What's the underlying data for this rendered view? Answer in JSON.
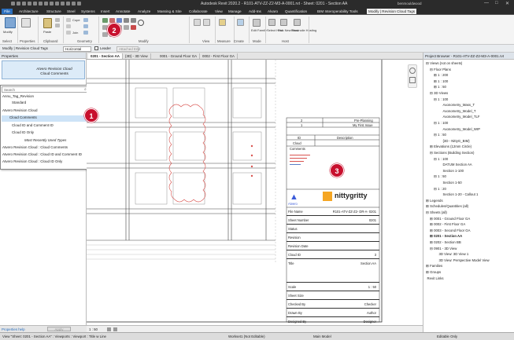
{
  "titlebar": {
    "title": "Autodesk Revit 2020.2 - R101-ATV-ZZ-Z2-M3-A-0001.rvt - Sheet: 0201 - Section AA",
    "user": "benmouldwood",
    "min": "—",
    "max": "□",
    "close": "✕"
  },
  "tabs": [
    "File",
    "Architecture",
    "Structure",
    "Steel",
    "Systems",
    "Insert",
    "Annotate",
    "Analyze",
    "Massing & Site",
    "Collaborate",
    "View",
    "Manage",
    "Add-Ins",
    "Alvaro",
    "Quantification",
    "BIM Interoperability Tools",
    "Modify | Revision Cloud Tags"
  ],
  "ribbon": {
    "modify": "Modify",
    "paste": "Paste",
    "cut": "Cope",
    "join": "Join",
    "edit_family": "Edit Family",
    "select_host": "Select Host",
    "pick_new_host": "Pick New Host",
    "reconcile_hosting": "Reconcile Hosting",
    "groups": [
      "Select",
      "Properties",
      "Clipboard",
      "Geometry",
      "Modify",
      "View",
      "Measure",
      "Create",
      "Mode",
      "Host"
    ]
  },
  "ctxbar": {
    "label": "Modify | Revision Cloud Tags",
    "orientation": "Horizontal",
    "leader": "Leader",
    "attached_end": "Attached End"
  },
  "properties": {
    "header": "Properties",
    "type_name": "Atvero Revision Cloud",
    "type_sub": "Cloud Comments",
    "search_placeholder": "Search",
    "items": [
      {
        "label": "Annu_Tag_Revision",
        "kind": "group"
      },
      {
        "label": "Standard",
        "kind": "item"
      },
      {
        "label": "Atvero Revision Cloud",
        "kind": "group"
      },
      {
        "label": "Cloud Comments",
        "kind": "selected"
      },
      {
        "label": "Cloud ID and Comment ID",
        "kind": "item"
      },
      {
        "label": "Cloud ID Only",
        "kind": "item"
      },
      {
        "label": "Most Recently Used Types",
        "kind": "italic"
      },
      {
        "label": "Atvero Revision Cloud : Cloud Comments",
        "kind": "group"
      },
      {
        "label": "Atvero Revision Cloud : Cloud ID and Comment ID",
        "kind": "group"
      },
      {
        "label": "Atvero Revision Cloud : Cloud ID Only",
        "kind": "group"
      }
    ],
    "help": "Properties help",
    "apply": "Apply"
  },
  "viewtabs": [
    "0201 - Section AA",
    "{3D} - 3D View",
    "0001 - Ground Floor GA",
    "0002 - First Floor GA"
  ],
  "titleblock": {
    "rev_rows": [
      {
        "rev": "2",
        "desc": "Pre-Planning"
      },
      {
        "rev": "1",
        "desc": "My First Issue"
      }
    ],
    "id_header": "ID",
    "desc_header": "Description",
    "cloud_label": "Cloud",
    "comments_label": "Comments",
    "brand": "Atvero",
    "company": "nittygritty",
    "fields": [
      {
        "k": "File Name",
        "v": "R101-ATV-ZZ-Z2- DR-A- 0201"
      },
      {
        "k": "Sheet Number",
        "v": "0201"
      },
      {
        "k": "Status",
        "v": ""
      },
      {
        "k": "Revision",
        "v": ""
      },
      {
        "k": "Revision Date",
        "v": ""
      },
      {
        "k": "Cloud ID",
        "v": "3"
      },
      {
        "k": "Title",
        "v": "Section AA"
      },
      {
        "k": "Scale",
        "v": "1 : 50"
      },
      {
        "k": "Sheet Size",
        "v": ""
      },
      {
        "k": "Checked By",
        "v": "Checker"
      },
      {
        "k": "Drawn By",
        "v": "Author"
      },
      {
        "k": "Designed By",
        "v": "Designer"
      }
    ]
  },
  "viewbottom": {
    "scale": "1 : 50"
  },
  "browser": {
    "header": "Project Browser - R101-ATV-ZZ-Z2-M3-A-0001.rvt",
    "nodes": [
      {
        "t": "Views (not on sheets)",
        "lvl": 0,
        "exp": "⊟"
      },
      {
        "t": "Floor Plans",
        "lvl": 1,
        "exp": "⊟"
      },
      {
        "t": "1 : 200",
        "lvl": 2,
        "exp": "⊞"
      },
      {
        "t": "1 : 100",
        "lvl": 2,
        "exp": "⊞"
      },
      {
        "t": "1 : 50",
        "lvl": 2,
        "exp": "⊞"
      },
      {
        "t": "3D Views",
        "lvl": 1,
        "exp": "⊟"
      },
      {
        "t": "1 : 100",
        "lvl": 2,
        "exp": "⊟"
      },
      {
        "t": "Axonometry_Mass_T",
        "lvl": 4,
        "exp": ""
      },
      {
        "t": "Axonometry_Model_T",
        "lvl": 4,
        "exp": ""
      },
      {
        "t": "Axonometry_Model_TLF",
        "lvl": 4,
        "exp": ""
      },
      {
        "t": "1 : 100",
        "lvl": 2,
        "exp": "⊟"
      },
      {
        "t": "Axonometry_Model_WIP",
        "lvl": 4,
        "exp": ""
      },
      {
        "t": "1 : 50",
        "lvl": 2,
        "exp": "⊟"
      },
      {
        "t": "{3D - NittyG_BIM}",
        "lvl": 4,
        "exp": ""
      },
      {
        "t": "Elevations (12mm Circle)",
        "lvl": 1,
        "exp": "⊞"
      },
      {
        "t": "Sections (Building Section)",
        "lvl": 1,
        "exp": "⊟"
      },
      {
        "t": "1 : 100",
        "lvl": 2,
        "exp": "⊟"
      },
      {
        "t": "DATUM Section AA",
        "lvl": 4,
        "exp": ""
      },
      {
        "t": "Section 1-100",
        "lvl": 4,
        "exp": ""
      },
      {
        "t": "1 : 50",
        "lvl": 2,
        "exp": "⊟"
      },
      {
        "t": "Section 1-50",
        "lvl": 4,
        "exp": ""
      },
      {
        "t": "1 : 20",
        "lvl": 2,
        "exp": "⊟"
      },
      {
        "t": "Section 1-20 - Callout 1",
        "lvl": 4,
        "exp": ""
      },
      {
        "t": "Legends",
        "lvl": 0,
        "exp": "⊞"
      },
      {
        "t": "Schedules/Quantities (all)",
        "lvl": 0,
        "exp": "⊞"
      },
      {
        "t": "Sheets (all)",
        "lvl": 0,
        "exp": "⊟"
      },
      {
        "t": "0001 - Ground Floor GA",
        "lvl": 1,
        "exp": "⊞"
      },
      {
        "t": "0002 - First Floor GA",
        "lvl": 1,
        "exp": "⊞"
      },
      {
        "t": "0003 - Second Floor GA",
        "lvl": 1,
        "exp": "⊞"
      },
      {
        "t": "0201 - Section AA",
        "lvl": 1,
        "exp": "⊞",
        "bold": true
      },
      {
        "t": "0202 - Section BB",
        "lvl": 1,
        "exp": "⊞"
      },
      {
        "t": "0901 - 3D View",
        "lvl": 1,
        "exp": "⊟"
      },
      {
        "t": "3D View: 3D View 1",
        "lvl": 3,
        "exp": ""
      },
      {
        "t": "3D View: Perspective Model View",
        "lvl": 3,
        "exp": ""
      },
      {
        "t": "Families",
        "lvl": 0,
        "exp": "⊞"
      },
      {
        "t": "Groups",
        "lvl": 0,
        "exp": "⊞"
      },
      {
        "t": "Revit Links",
        "lvl": 0,
        "exp": ""
      }
    ]
  },
  "status": {
    "text": "View \"Sheet: 0201 - Section AA\" : Viewports : Viewport : Title w Line",
    "workset": "Workset1 (Not Editable)",
    "model": "Main Model",
    "editable": "Editable Only"
  },
  "badges": [
    "1",
    "2",
    "3"
  ],
  "colors": {
    "accent": "#c8102e",
    "file_tab": "#2a6ebd",
    "selected": "#cde3f7"
  }
}
